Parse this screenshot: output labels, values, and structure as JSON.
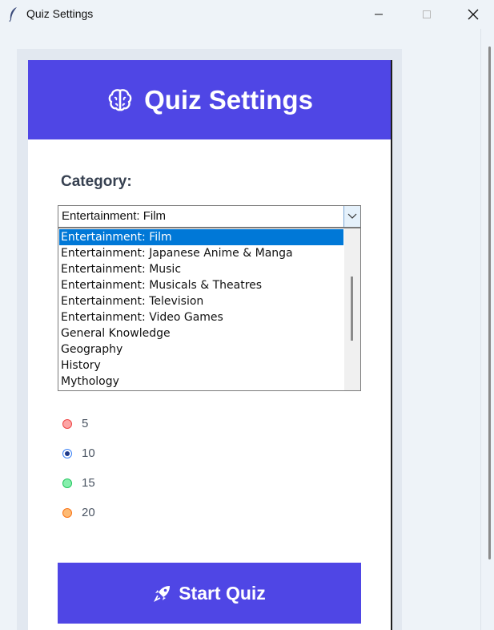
{
  "window": {
    "title": "Quiz Settings",
    "app_icon": "feather-icon",
    "controls": [
      "minimize-icon",
      "maximize-icon",
      "close-icon"
    ]
  },
  "header": {
    "icon": "brain-icon",
    "title": "Quiz Settings",
    "bg_color": "#4f46e5"
  },
  "category": {
    "label": "Category:",
    "selected_value": "Entertainment: Film",
    "options": [
      "Entertainment: Film",
      "Entertainment: Japanese Anime & Manga",
      "Entertainment: Music",
      "Entertainment: Musicals & Theatres",
      "Entertainment: Television",
      "Entertainment: Video Games",
      "General Knowledge",
      "Geography",
      "History",
      "Mythology"
    ],
    "highlighted_option": "Entertainment: Film",
    "highlight_color": "#0078d7"
  },
  "questions": {
    "options": [
      {
        "label": "5",
        "color": "#f87171",
        "selected": false
      },
      {
        "label": "10",
        "color": "#3b82f6",
        "selected": true
      },
      {
        "label": "15",
        "color": "#4ade80",
        "selected": false
      },
      {
        "label": "20",
        "color": "#fb923c",
        "selected": false
      }
    ]
  },
  "start_button": {
    "icon": "rocket-icon",
    "label": "Start Quiz",
    "bg_color": "#4f46e5"
  }
}
